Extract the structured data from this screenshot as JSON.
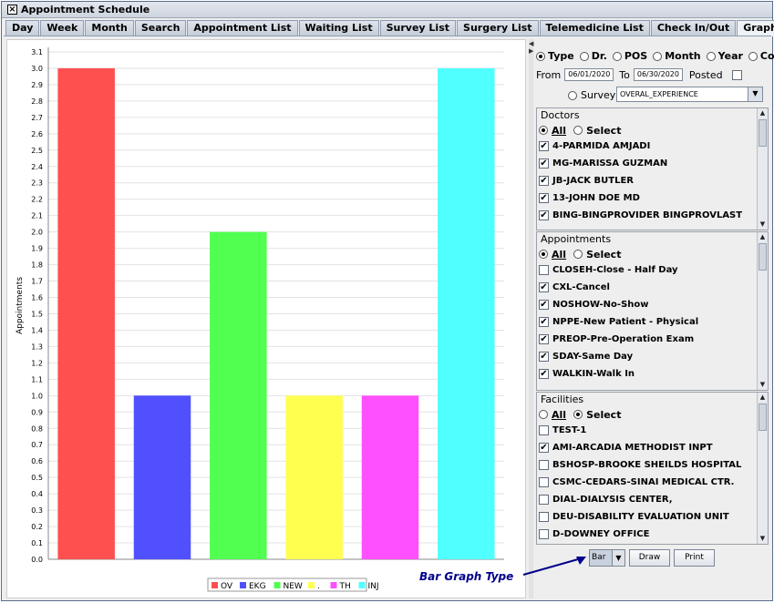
{
  "window": {
    "title": "Appointment Schedule"
  },
  "tabs": [
    "Day",
    "Week",
    "Month",
    "Search",
    "Appointment List",
    "Waiting List",
    "Survey List",
    "Surgery List",
    "Telemedicine List",
    "Check In/Out",
    "Graphs"
  ],
  "active_tab": "Graphs",
  "filters": {
    "group_by": [
      {
        "label": "Type",
        "selected": true
      },
      {
        "label": "Dr.",
        "selected": false
      },
      {
        "label": "POS",
        "selected": false
      },
      {
        "label": "Month",
        "selected": false
      },
      {
        "label": "Year",
        "selected": false
      },
      {
        "label": "Confirm",
        "selected": false
      }
    ],
    "from_label": "From",
    "from_value": "06/01/2020",
    "to_label": "To",
    "to_value": "06/30/2020",
    "posted_label": "Posted",
    "survey_label": "Survey",
    "survey_value": "OVERAL_EXPERIENCE"
  },
  "doctors": {
    "title": "Doctors",
    "all_label": "All",
    "select_label": "Select",
    "mode": "All",
    "items": [
      {
        "label": "4-PARMIDA AMJADI",
        "checked": true
      },
      {
        "label": "MG-MARISSA GUZMAN",
        "checked": true
      },
      {
        "label": "JB-JACK BUTLER",
        "checked": true
      },
      {
        "label": "13-JOHN DOE MD",
        "checked": true
      },
      {
        "label": "BING-BINGPROVIDER BINGPROVLAST",
        "checked": true
      }
    ]
  },
  "appointments": {
    "title": "Appointments",
    "all_label": "All",
    "select_label": "Select",
    "mode": "All",
    "items": [
      {
        "label": "CLOSEH-Close - Half Day",
        "checked": false
      },
      {
        "label": "CXL-Cancel",
        "checked": true
      },
      {
        "label": "NOSHOW-No-Show",
        "checked": true
      },
      {
        "label": "NPPE-New Patient - Physical",
        "checked": true
      },
      {
        "label": "PREOP-Pre-Operation Exam",
        "checked": true
      },
      {
        "label": "SDAY-Same Day",
        "checked": true
      },
      {
        "label": "WALKIN-Walk In",
        "checked": true
      }
    ]
  },
  "facilities": {
    "title": "Facilities",
    "all_label": "All",
    "select_label": "Select",
    "mode": "Select",
    "items": [
      {
        "label": "TEST-1",
        "checked": false
      },
      {
        "label": "AMI-ARCADIA METHODIST INPT",
        "checked": true
      },
      {
        "label": "BSHOSP-BROOKE SHEILDS HOSPITAL",
        "checked": false
      },
      {
        "label": "CSMC-CEDARS-SINAI MEDICAL CTR.",
        "checked": false
      },
      {
        "label": "DIAL-DIALYSIS CENTER,",
        "checked": false
      },
      {
        "label": "DEU-DISABILITY EVALUATION UNIT",
        "checked": false
      },
      {
        "label": "D-DOWNEY OFFICE",
        "checked": false
      }
    ]
  },
  "actions": {
    "graph_type": "Bar",
    "draw_label": "Draw",
    "print_label": "Print"
  },
  "annotation": "Bar Graph Type",
  "colors": {
    "accent": "#00008b",
    "window_border": "#5a6e8a"
  },
  "chart_data": {
    "type": "bar",
    "categories": [
      "OV",
      "EKG",
      "NEW",
      ".",
      "TH",
      "INJ"
    ],
    "values": [
      3.0,
      1.0,
      2.0,
      1.0,
      1.0,
      3.0
    ],
    "colors": [
      "#ff5050",
      "#5050ff",
      "#50ff50",
      "#ffff50",
      "#ff50ff",
      "#50ffff"
    ],
    "xlabel": "",
    "ylabel": "Appointments",
    "ylim": [
      0.0,
      3.1
    ],
    "yticks": [
      "0.0",
      "0.1",
      "0.2",
      "0.3",
      "0.4",
      "0.5",
      "0.6",
      "0.7",
      "0.8",
      "0.9",
      "1.0",
      "1.1",
      "1.2",
      "1.3",
      "1.4",
      "1.5",
      "1.6",
      "1.7",
      "1.8",
      "1.9",
      "2.0",
      "2.1",
      "2.2",
      "2.3",
      "2.4",
      "2.5",
      "2.6",
      "2.7",
      "2.8",
      "2.9",
      "3.0",
      "3.1"
    ],
    "grid": true,
    "legend": "bottom-center"
  }
}
